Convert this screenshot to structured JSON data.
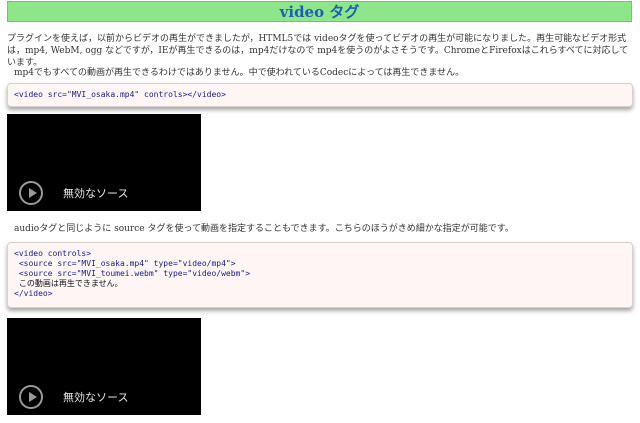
{
  "header": {
    "title": "video タグ"
  },
  "intro": {
    "p1": "プラグインを使えば，以前からビデオの再生ができましたが，HTML5では videoタグを使ってビデオの再生が可能になりました。再生可能なビデオ形式は，mp4, WebM, ogg などですが，IEが再生できるのは，mp4だけなので mp4を使うのがよさそうです。ChromeとFirefoxはこれらすべてに対応しています。",
    "p2": "mp4でもすべての動画が再生できるわけではありません。中で使われているCodecによっては再生できません。"
  },
  "code1": {
    "line": "<video src=\"MVI_osaka.mp4\" controls></video>"
  },
  "video1": {
    "message": "無効なソース"
  },
  "section2": {
    "p": "audioタグと同じように source タグを使って動画を指定することもできます。こちらのほうがきめ細かな指定が可能です。"
  },
  "code2": {
    "lines": [
      "<video controls>",
      " <source src=\"MVI_osaka.mp4\" type=\"video/mp4\">",
      " <source src=\"MVI_toumei.webm\" type=\"video/webm\">",
      " この動画は再生できません。",
      "</video>"
    ]
  },
  "video2": {
    "message": "無効なソース"
  }
}
